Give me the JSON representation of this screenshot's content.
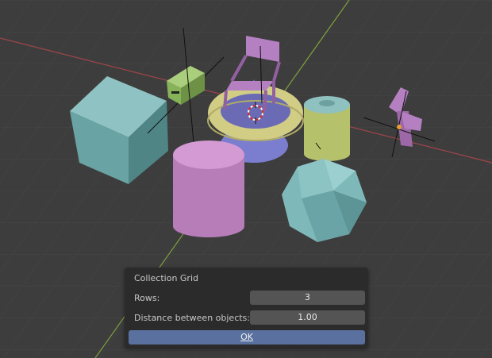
{
  "dialog": {
    "title": "Collection Grid",
    "rows_label": "Rows:",
    "rows_value": "3",
    "distance_label": "Distance between objects:",
    "distance_value": "1.00",
    "ok_label": "OK"
  },
  "colors": {
    "viewport_bg": "#3d3d3d",
    "x_axis": "#a0454a",
    "y_axis": "#7da23c",
    "dialog_bg": "#2b2b2b",
    "field_bg": "#545454",
    "ok_button": "#5a71a0"
  },
  "scene_objects": [
    "cube",
    "pink-cylinder",
    "radio",
    "chair",
    "torus",
    "cone",
    "canister",
    "icosphere",
    "faucet",
    "3d-cursor"
  ]
}
